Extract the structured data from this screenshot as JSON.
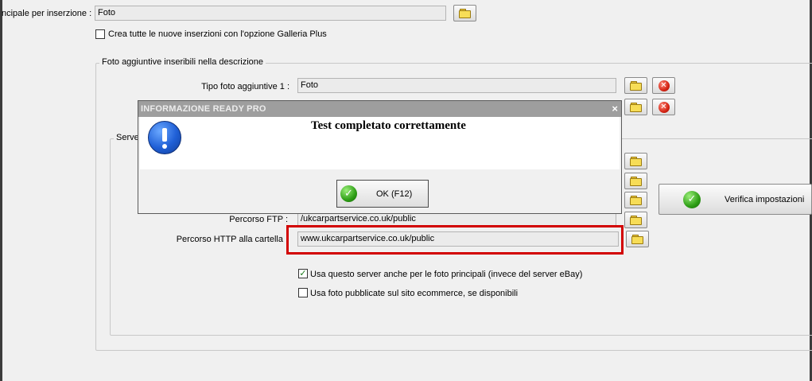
{
  "main_photo": {
    "label": "ncipale per inserzione :",
    "value": "Foto"
  },
  "galleria_plus": {
    "label": "Crea tutte le nuove inserzioni con l'opzione Galleria Plus",
    "checked": false
  },
  "additional_photos": {
    "group_title": "Foto aggiuntive inseribili nella descrizione",
    "rows": [
      {
        "label": "Tipo foto aggiuntive 1 :",
        "value": "Foto"
      },
      {
        "label": "",
        "value": ""
      }
    ]
  },
  "server": {
    "group_title": "Serve",
    "ftp_path_label": "Percorso FTP :",
    "ftp_path_value": "/ukcarpartservice.co.uk/public",
    "http_path_label": "Percorso HTTP alla cartella",
    "http_path_value": "www.ukcarpartservice.co.uk/public",
    "use_for_main": {
      "label": "Usa questo server anche per le foto principali (invece del server eBay)",
      "checked": true
    },
    "use_ecommerce": {
      "label": "Usa foto pubblicate sul sito ecommerce, se disponibili",
      "checked": false
    },
    "verify_button": "Verifica impostazioni"
  },
  "dialog": {
    "title": "INFORMAZIONE READY PRO",
    "close": "×",
    "message": "Test completato correttamente",
    "ok_button": "OK (F12)"
  },
  "icons": {
    "folder": "folder-icon",
    "delete": "delete-icon",
    "info": "info-icon",
    "ok": "checkmark-icon"
  },
  "colors": {
    "highlight": "#d20000",
    "dialog_title_bg": "#9e9e9e",
    "window_bg": "#f0f0f0"
  }
}
